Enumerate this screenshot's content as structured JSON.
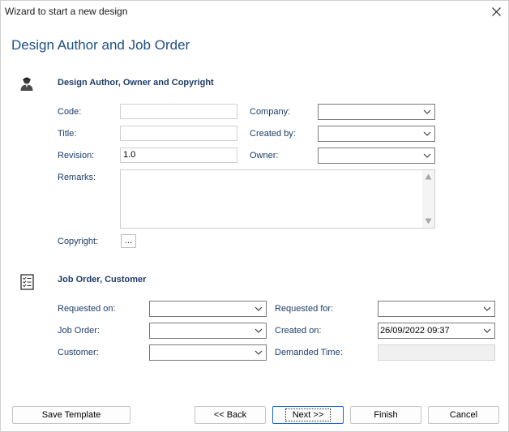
{
  "window": {
    "title": "Wizard to start a new design"
  },
  "page_title": "Design Author and Job Order",
  "author_section": {
    "title": "Design Author, Owner and Copyright",
    "code_label": "Code:",
    "code_value": "",
    "title_label": "Title:",
    "title_value": "",
    "revision_label": "Revision:",
    "revision_value": "1.0",
    "remarks_label": "Remarks:",
    "copyright_label": "Copyright:",
    "copyright_button": "...",
    "company_label": "Company:",
    "company_value": "",
    "created_by_label": "Created by:",
    "created_by_value": "",
    "owner_label": "Owner:",
    "owner_value": ""
  },
  "job_section": {
    "title": "Job Order, Customer",
    "requested_on_label": "Requested on:",
    "requested_on_value": "",
    "job_order_label": "Job Order:",
    "job_order_value": "",
    "customer_label": "Customer:",
    "customer_value": "",
    "requested_for_label": "Requested for:",
    "requested_for_value": "",
    "created_on_label": "Created on:",
    "created_on_value": "26/09/2022 09:37",
    "demanded_time_label": "Demanded Time:",
    "demanded_time_value": ""
  },
  "buttons": {
    "save_template": "Save Template",
    "back": "<< Back",
    "next": "Next >>",
    "finish": "Finish",
    "cancel": "Cancel"
  },
  "icons": {
    "close": "close-icon",
    "author": "user-icon",
    "job_order": "checklist-icon",
    "dropdown": "chevron-down-icon"
  },
  "colors": {
    "heading": "#1e4f86",
    "label": "#1d3d6a",
    "default_button_border": "#1967d2"
  }
}
